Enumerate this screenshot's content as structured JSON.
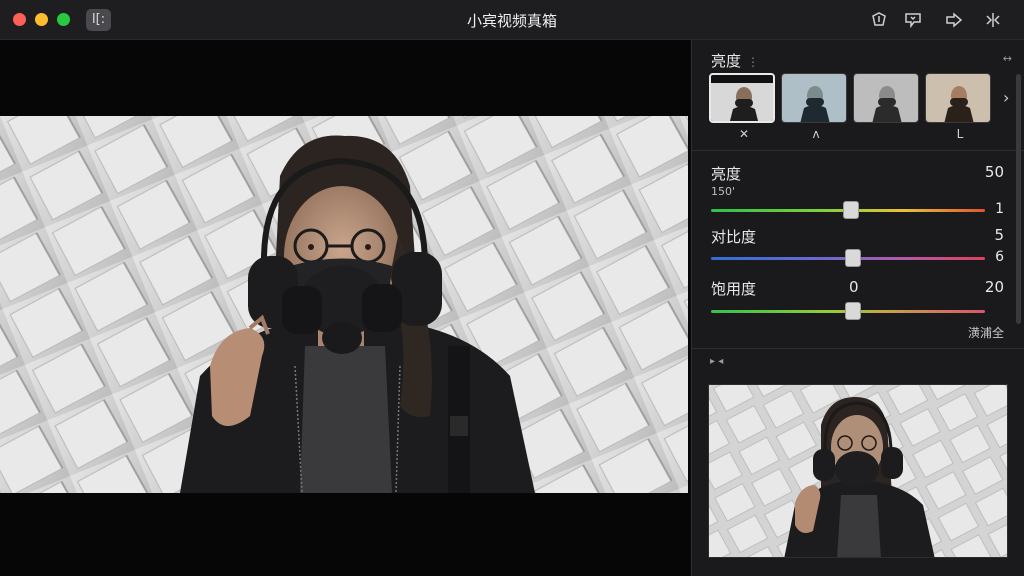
{
  "window": {
    "title": "小宾视频真箱",
    "app_badge": "I[:"
  },
  "toolbar": {
    "icons": [
      "shield-icon",
      "message-icon",
      "share-arrow-icon",
      "split-view-icon"
    ]
  },
  "panel": {
    "section_title": "亮度",
    "section_menu": "⋮",
    "corner_glyph": "↔",
    "thumbnails": [
      {
        "label": "✕",
        "selected": true
      },
      {
        "label": "ʌ",
        "selected": false
      },
      {
        "label": "",
        "selected": false
      },
      {
        "label": "L",
        "selected": false
      }
    ],
    "params": [
      {
        "label": "亮度",
        "value": "50",
        "sub": "150'",
        "end_value": "1",
        "position": 0.51
      },
      {
        "label": "对比度",
        "value": "5",
        "end_value": "6",
        "position": 0.52
      },
      {
        "label": "饱用度",
        "mid_value": "0",
        "value": "20",
        "position": 0.52
      }
    ],
    "reset_label": "潢浦全",
    "mini_bar": "▸ ◂"
  },
  "colors": {
    "accent": "#e9e9e9",
    "panel_bg": "#1a1a1c",
    "titlebar_bg": "#1e1e20"
  }
}
